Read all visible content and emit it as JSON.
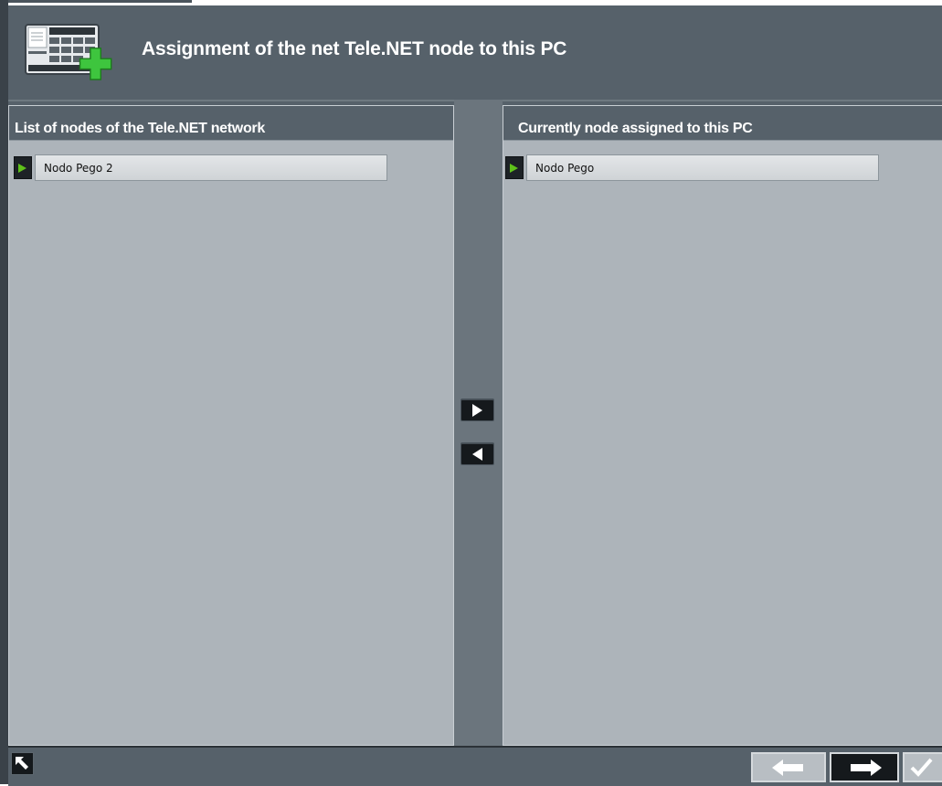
{
  "header": {
    "title": "Assignment of the net Tele.NET node to this PC",
    "icon": "network-table-add-icon"
  },
  "left_panel": {
    "title": "List of nodes of the Tele.NET network",
    "items": [
      {
        "label": "Nodo Pego 2"
      }
    ]
  },
  "right_panel": {
    "title": "Currently node assigned to this PC",
    "items": [
      {
        "label": "Nodo Pego"
      }
    ]
  },
  "transfer": {
    "assign_icon": "arrow-right-icon",
    "unassign_icon": "arrow-left-icon"
  },
  "footer": {
    "back_icon": "return-arrow-icon",
    "prev_icon": "arrow-left-icon",
    "next_icon": "arrow-right-icon",
    "ok_icon": "checkmark-icon"
  },
  "colors": {
    "frame": "#56616a",
    "panel_bg": "#adb4ba",
    "marker_arrow": "#5fc21a",
    "accent_plus": "#3ec53e"
  }
}
